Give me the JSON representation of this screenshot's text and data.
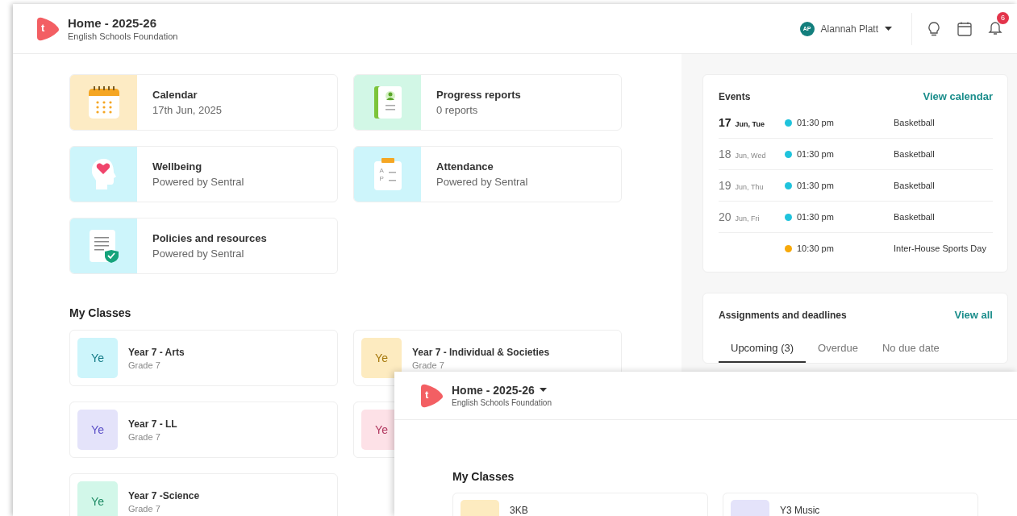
{
  "header": {
    "logo": "t",
    "title": "Home - 2025-26",
    "subtitle": "English Schools Foundation",
    "user": {
      "initials": "AP",
      "name": "Alannah Platt"
    },
    "notification_count": "6"
  },
  "tiles": [
    {
      "kind": "calendar",
      "title": "Calendar",
      "subtitle": "17th Jun, 2025"
    },
    {
      "kind": "progress",
      "title": "Progress reports",
      "subtitle": "0 reports"
    },
    {
      "kind": "wellbeing",
      "title": "Wellbeing",
      "subtitle": "Powered by Sentral"
    },
    {
      "kind": "attendance",
      "title": "Attendance",
      "subtitle": "Powered by Sentral",
      "icon_letters": [
        "A",
        "P"
      ]
    },
    {
      "kind": "policies",
      "title": "Policies and resources",
      "subtitle": "Powered by Sentral"
    }
  ],
  "my_classes": {
    "heading": "My Classes",
    "classes": [
      {
        "abbr": "Ye",
        "name": "Year 7 - Arts",
        "grade": "Grade 7",
        "color": "#cdf5fb"
      },
      {
        "abbr": "Ye",
        "name": "Year 7 - Individual & Societies",
        "grade": "Grade 7",
        "color": "#fdebc0"
      },
      {
        "abbr": "Ye",
        "name": "Year 7 - LL",
        "grade": "Grade 7",
        "color": "#e4e3fa"
      },
      {
        "abbr": "Ye",
        "color": "#fde1e7"
      },
      {
        "abbr": "Ye",
        "name": "Year 7 -Science",
        "grade": "Grade 7",
        "color": "#d2f7e9"
      }
    ]
  },
  "events": {
    "title": "Events",
    "link": "View calendar",
    "rows": [
      {
        "day": "17",
        "date": "Jun, Tue",
        "today": true,
        "time": "01:30 pm",
        "color": "#1fc3dc",
        "title": "Basketball"
      },
      {
        "day": "18",
        "date": "Jun, Wed",
        "today": false,
        "time": "01:30 pm",
        "color": "#1fc3dc",
        "title": "Basketball"
      },
      {
        "day": "19",
        "date": "Jun, Thu",
        "today": false,
        "time": "01:30 pm",
        "color": "#1fc3dc",
        "title": "Basketball"
      },
      {
        "day": "20",
        "date": "Jun, Fri",
        "today": false,
        "time": "01:30 pm",
        "color": "#1fc3dc",
        "title": "Basketball"
      },
      {
        "time": "10:30 pm",
        "color": "#f7a90a",
        "title": "Inter-House Sports Day"
      }
    ]
  },
  "assignments": {
    "title": "Assignments and deadlines",
    "link": "View all",
    "tabs": [
      {
        "label": "Upcoming (3)",
        "selected": true
      },
      {
        "label": "Overdue",
        "selected": false
      },
      {
        "label": "No due date",
        "selected": false
      }
    ]
  },
  "overlay_window": {
    "logo": "t",
    "title": "Home - 2025-26",
    "subtitle": "English Schools Foundation",
    "heading": "My Classes",
    "classes": [
      {
        "name": "3KB",
        "color": "#fdebc0"
      },
      {
        "name": "Y3 Music",
        "color": "#e4e3fa"
      }
    ]
  }
}
